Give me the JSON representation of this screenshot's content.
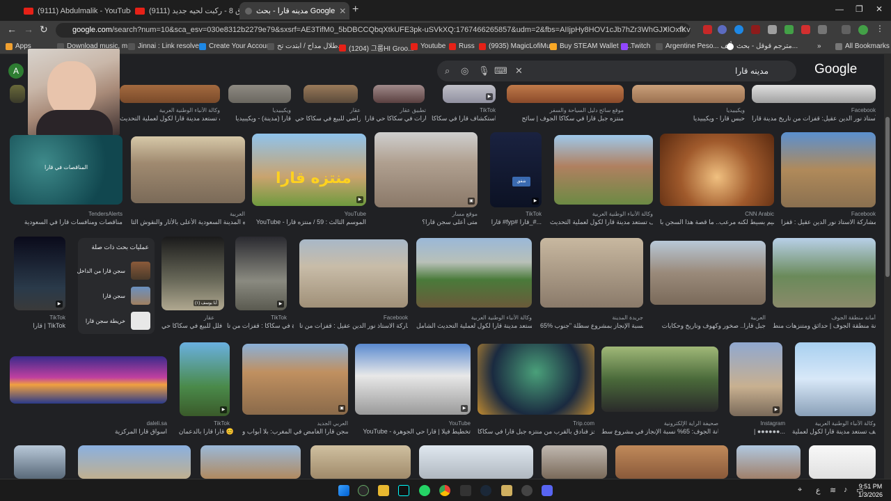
{
  "browser": {
    "tabs": [
      {
        "label": "(9111) Abdulmalik - YouTube",
        "active": false
      },
      {
        "label": "(9111) فلوق 8 - ركبت لحيه جديد...",
        "active": false
      },
      {
        "label": "مدينه قارا - بحث Google",
        "active": true
      }
    ],
    "url_host": "google.com",
    "url_rest": "/search?num=10&sca_esv=030e8312b2279e79&sxsrf=AE3TifM0_5bDBCCQbqXtkUFE3pk-uSVkXQ:1767466265857&udm=2&fbs=AIIjpHy8HOV1cJb7hZr3WhGJXlOxfKvJh81XRwO1RS_P_5G8is",
    "bookmarks": [
      "Apps",
      "Download music, m...",
      "Jinnai : Link resolver...",
      "Create Your Account",
      "طلال مداح / ابتدت تح...",
      "(1204) 그룹HI Groo...",
      "Youtube",
      "Russ",
      "(9935) MagicLofiMu...",
      "Buy STEAM Wallet C...",
      "Twitch",
      "Argentine Peso... ألف",
      "مترجم قوقل - بحث...",
      "All Bookmarks"
    ]
  },
  "search": {
    "query": "مدينه قارا",
    "logo": "Google",
    "account_initial": "A"
  },
  "results": [
    {
      "src": "وكالة الأنباء الوطنية العربية",
      "title": "كيف تستعد مدينة قارا لكول لعملية التحديث...",
      "row": 0
    },
    {
      "src": "ويكيبيديا",
      "title": "قارا (مدينة) - ويكيبيديا",
      "row": 0
    },
    {
      "src": "عقار",
      "title": "أراضي للبيع في سكاكا حي ...",
      "row": 0
    },
    {
      "src": "تطبيق عقار",
      "title": "عقارات في سكاكا حي قارا ...",
      "row": 0
    },
    {
      "src": "TikTok",
      "title": "استكشاف قارا في سكاكا ...",
      "row": 0
    },
    {
      "src": "موقع سائح دليل السياحة والسفر",
      "title": "منتزه جبل قارا في سكاكا الجوف | سائح",
      "row": 0
    },
    {
      "src": "ويكيبيديا",
      "title": "حبس قارا - ويكيبيديا",
      "row": 0
    },
    {
      "src": "Facebook",
      "title": "الأستاذ نور الدين عقيل: قفزات من تاريخ مدينة قارا ...",
      "row": 0
    },
    {
      "src": "TendersAlerts",
      "title": "مناقصات ومنافسات قارا في السعودية",
      "row": 1
    },
    {
      "src": "العربية",
      "title": "هذه المدينة السعودية الأعلى بالأثار والنقوش الثا...",
      "row": 1
    },
    {
      "src": "YouTube",
      "title": "YouTube - الموسم الثالث : 59 / منتزه قارا",
      "row": 1
    },
    {
      "src": "موقع مسار",
      "title": "متى أعلى سجن قارا؟",
      "row": 1
    },
    {
      "src": "TikTok",
      "title": "قارا #fyp# قارا_#...",
      "row": 1
    },
    {
      "src": "وكالة الأنباء الوطنية العربية",
      "title": "كيف تستعد مدينة قارا لكول لعملية التحديث...",
      "row": 1
    },
    {
      "src": "CNN Arabic",
      "title": "تصميم بسيط لكنه مرعب.. ما قصة هذا السجن با...",
      "row": 1
    },
    {
      "src": "Facebook",
      "title": "مشاركة الاستاذ نور الدين عقيل : قفزا...",
      "row": 1
    },
    {
      "src": "TikTok",
      "title": "قارا | TikTok",
      "row": 2
    },
    {
      "src": "عقار",
      "title": "فلل للبيع في سكاكا حي ...",
      "row": 2
    },
    {
      "src": "TikTok",
      "title": "أمطار غزيرة في سكاكا : قفزات من تا...",
      "row": 2
    },
    {
      "src": "Facebook",
      "title": "مشاركة الاستاذ نور الدين عقيل : قفزات من تا...",
      "row": 2
    },
    {
      "src": "وكالة الأنباء الوطنية العربية",
      "title": "كيف تستعد مدينة قارا لكول لعملية التحديث الشامل...",
      "row": 2
    },
    {
      "src": "جريدة المدينة",
      "title": "65% نسبة الإنجاز بمشروع سطلة \"جنوب ...",
      "row": 2
    },
    {
      "src": "العربية",
      "title": "جبل قارا.. صخور وكهوف وتاريخ وحكايات",
      "row": 2
    },
    {
      "src": "أمانة منطقة الجوف",
      "title": "أمانة منطقة الجوف | حدائق ومتنزهات منط...",
      "row": 2
    },
    {
      "src": "daleli.sa",
      "title": "اسواق قارا المركزية",
      "row": 3
    },
    {
      "src": "TikTok",
      "title": "قارا قارا بالدعمان 😊",
      "row": 3
    },
    {
      "src": "العربي الجديد",
      "title": "سجن قارا الغامض في المغرب: بلا أبواب و...",
      "row": 3
    },
    {
      "src": "YouTube",
      "title": "YouTube - تخطيط فيلا | قارا حي الجوهرة",
      "row": 3
    },
    {
      "src": "Trip.com",
      "title": "احجز فنادق بالقرب من منتزه جبل قارا في سكاكا...",
      "row": 3
    },
    {
      "src": "صحيفة الراية الإلكترونية",
      "title": "أمانة الجوف: 65% نسبة الإنجاز في مشروع سط...",
      "row": 3
    },
    {
      "src": "Instagram",
      "title": "| ●●●●●●...",
      "row": 3
    },
    {
      "src": "وكالة الأنباء الوطنية العربية",
      "title": "كيف تستعد مدينة قارا لكول لعملية...",
      "row": 3
    }
  ],
  "related": {
    "heading": "عمليات بحث ذات صلة",
    "items": [
      "سجن قارا من الداخل",
      "سجن قارا",
      "خريطة سجن قارا"
    ]
  },
  "thumb_labels": {
    "tenders_overlay": "المناقصات في قارا",
    "poster_text": "منتزه قارا",
    "tiktok_phone": "شقق",
    "jeddah_badge": "أبا يوسف (١)"
  },
  "system": {
    "time": "9:51 PM",
    "date": "1/3/2026",
    "lang": "ع"
  },
  "colors": {
    "page_bg": "#202124",
    "browser_chrome": "#3c3c3c",
    "google_green": "#2e7d32"
  }
}
